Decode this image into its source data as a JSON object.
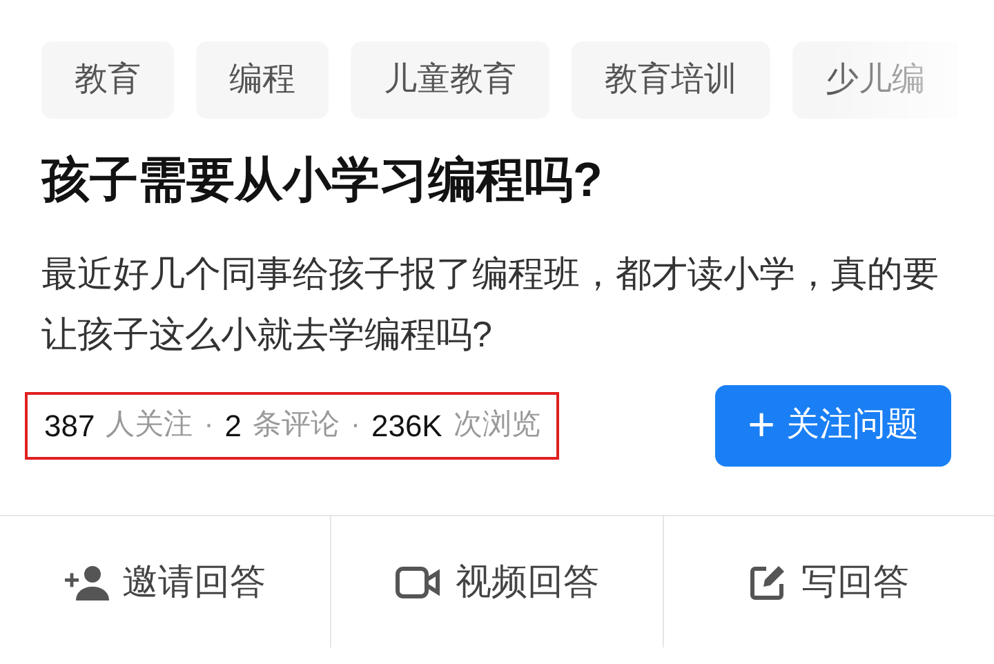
{
  "tags": [
    {
      "label": "教育"
    },
    {
      "label": "编程"
    },
    {
      "label": "儿童教育"
    },
    {
      "label": "教育培训"
    },
    {
      "label": "少儿编",
      "faded": true
    }
  ],
  "question": {
    "title": "孩子需要从小学习编程吗?",
    "description": "最近好几个同事给孩子报了编程班，都才读小学，真的要让孩子这么小就去学编程吗?"
  },
  "stats": {
    "highlighted": true,
    "items": [
      {
        "count": "387",
        "label": "人关注"
      },
      {
        "count": "2",
        "label": "条评论"
      },
      {
        "count": "236K",
        "label": "次浏览"
      }
    ],
    "separator": "·"
  },
  "follow_button": {
    "icon": "+",
    "label": "关注问题"
  },
  "actions": [
    {
      "kind": "invite",
      "label": "邀请回答"
    },
    {
      "kind": "video",
      "label": "视频回答"
    },
    {
      "kind": "write",
      "label": "写回答"
    }
  ]
}
